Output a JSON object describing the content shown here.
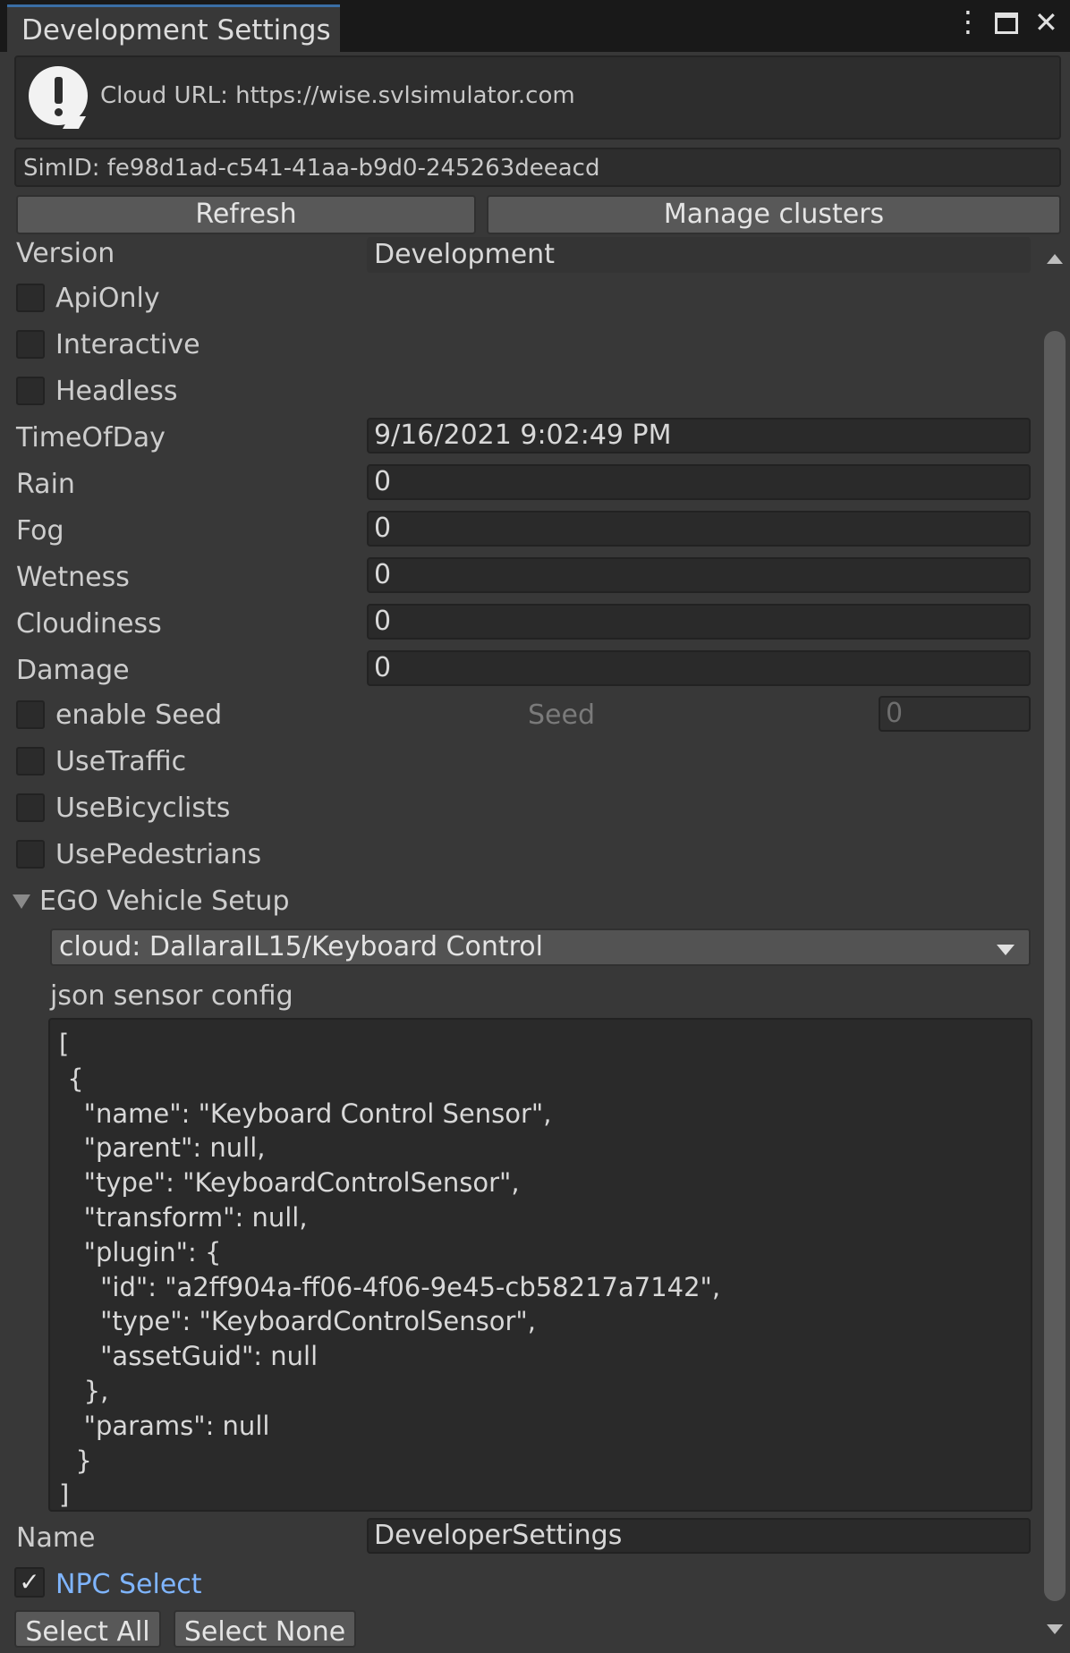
{
  "window": {
    "tab_title": "Development Settings",
    "controls": {
      "menu": "⋮",
      "maximize": "🗖",
      "close": "✕"
    }
  },
  "cloud": {
    "icon": "exclamation-icon",
    "url_text": "Cloud URL: https://wise.svlsimulator.com"
  },
  "sim_id": "SimID: fe98d1ad-c541-41aa-b9d0-245263deeacd",
  "buttons": {
    "refresh": "Refresh",
    "manage_clusters": "Manage clusters"
  },
  "fields": {
    "version": {
      "label": "Version",
      "value": "Development"
    },
    "api_only": {
      "label": "ApiOnly",
      "checked": false
    },
    "interactive": {
      "label": "Interactive",
      "checked": false
    },
    "headless": {
      "label": "Headless",
      "checked": false
    },
    "time_of_day": {
      "label": "TimeOfDay",
      "value": "9/16/2021 9:02:49 PM"
    },
    "rain": {
      "label": "Rain",
      "value": "0"
    },
    "fog": {
      "label": "Fog",
      "value": "0"
    },
    "wetness": {
      "label": "Wetness",
      "value": "0"
    },
    "cloudiness": {
      "label": "Cloudiness",
      "value": "0"
    },
    "damage": {
      "label": "Damage",
      "value": "0"
    },
    "enable_seed": {
      "label": "enable Seed",
      "checked": false
    },
    "seed": {
      "label": "Seed",
      "value": "0"
    },
    "use_traffic": {
      "label": "UseTraffic",
      "checked": false
    },
    "use_bicyclists": {
      "label": "UseBicyclists",
      "checked": false
    },
    "use_pedestrians": {
      "label": "UsePedestrians",
      "checked": false
    }
  },
  "ego": {
    "section_label": "EGO Vehicle Setup",
    "vehicle_selected": "cloud: DallaraIL15/Keyboard Control",
    "json_label": "json sensor config",
    "json_text": "[\n {\n   \"name\": \"Keyboard Control Sensor\",\n   \"parent\": null,\n   \"type\": \"KeyboardControlSensor\",\n   \"transform\": null,\n   \"plugin\": {\n     \"id\": \"a2ff904a-ff06-4f06-9e45-cb58217a7142\",\n     \"type\": \"KeyboardControlSensor\",\n     \"assetGuid\": null\n   },\n   \"params\": null\n  }\n]"
  },
  "name_field": {
    "label": "Name",
    "value": "DeveloperSettings"
  },
  "npc": {
    "label": "NPC Select",
    "checked": true,
    "select_all": "Select All",
    "select_none": "Select None"
  },
  "colors": {
    "background": "#383838",
    "accent": "#3a6ea5",
    "npc_label": "#7fb5ff"
  }
}
